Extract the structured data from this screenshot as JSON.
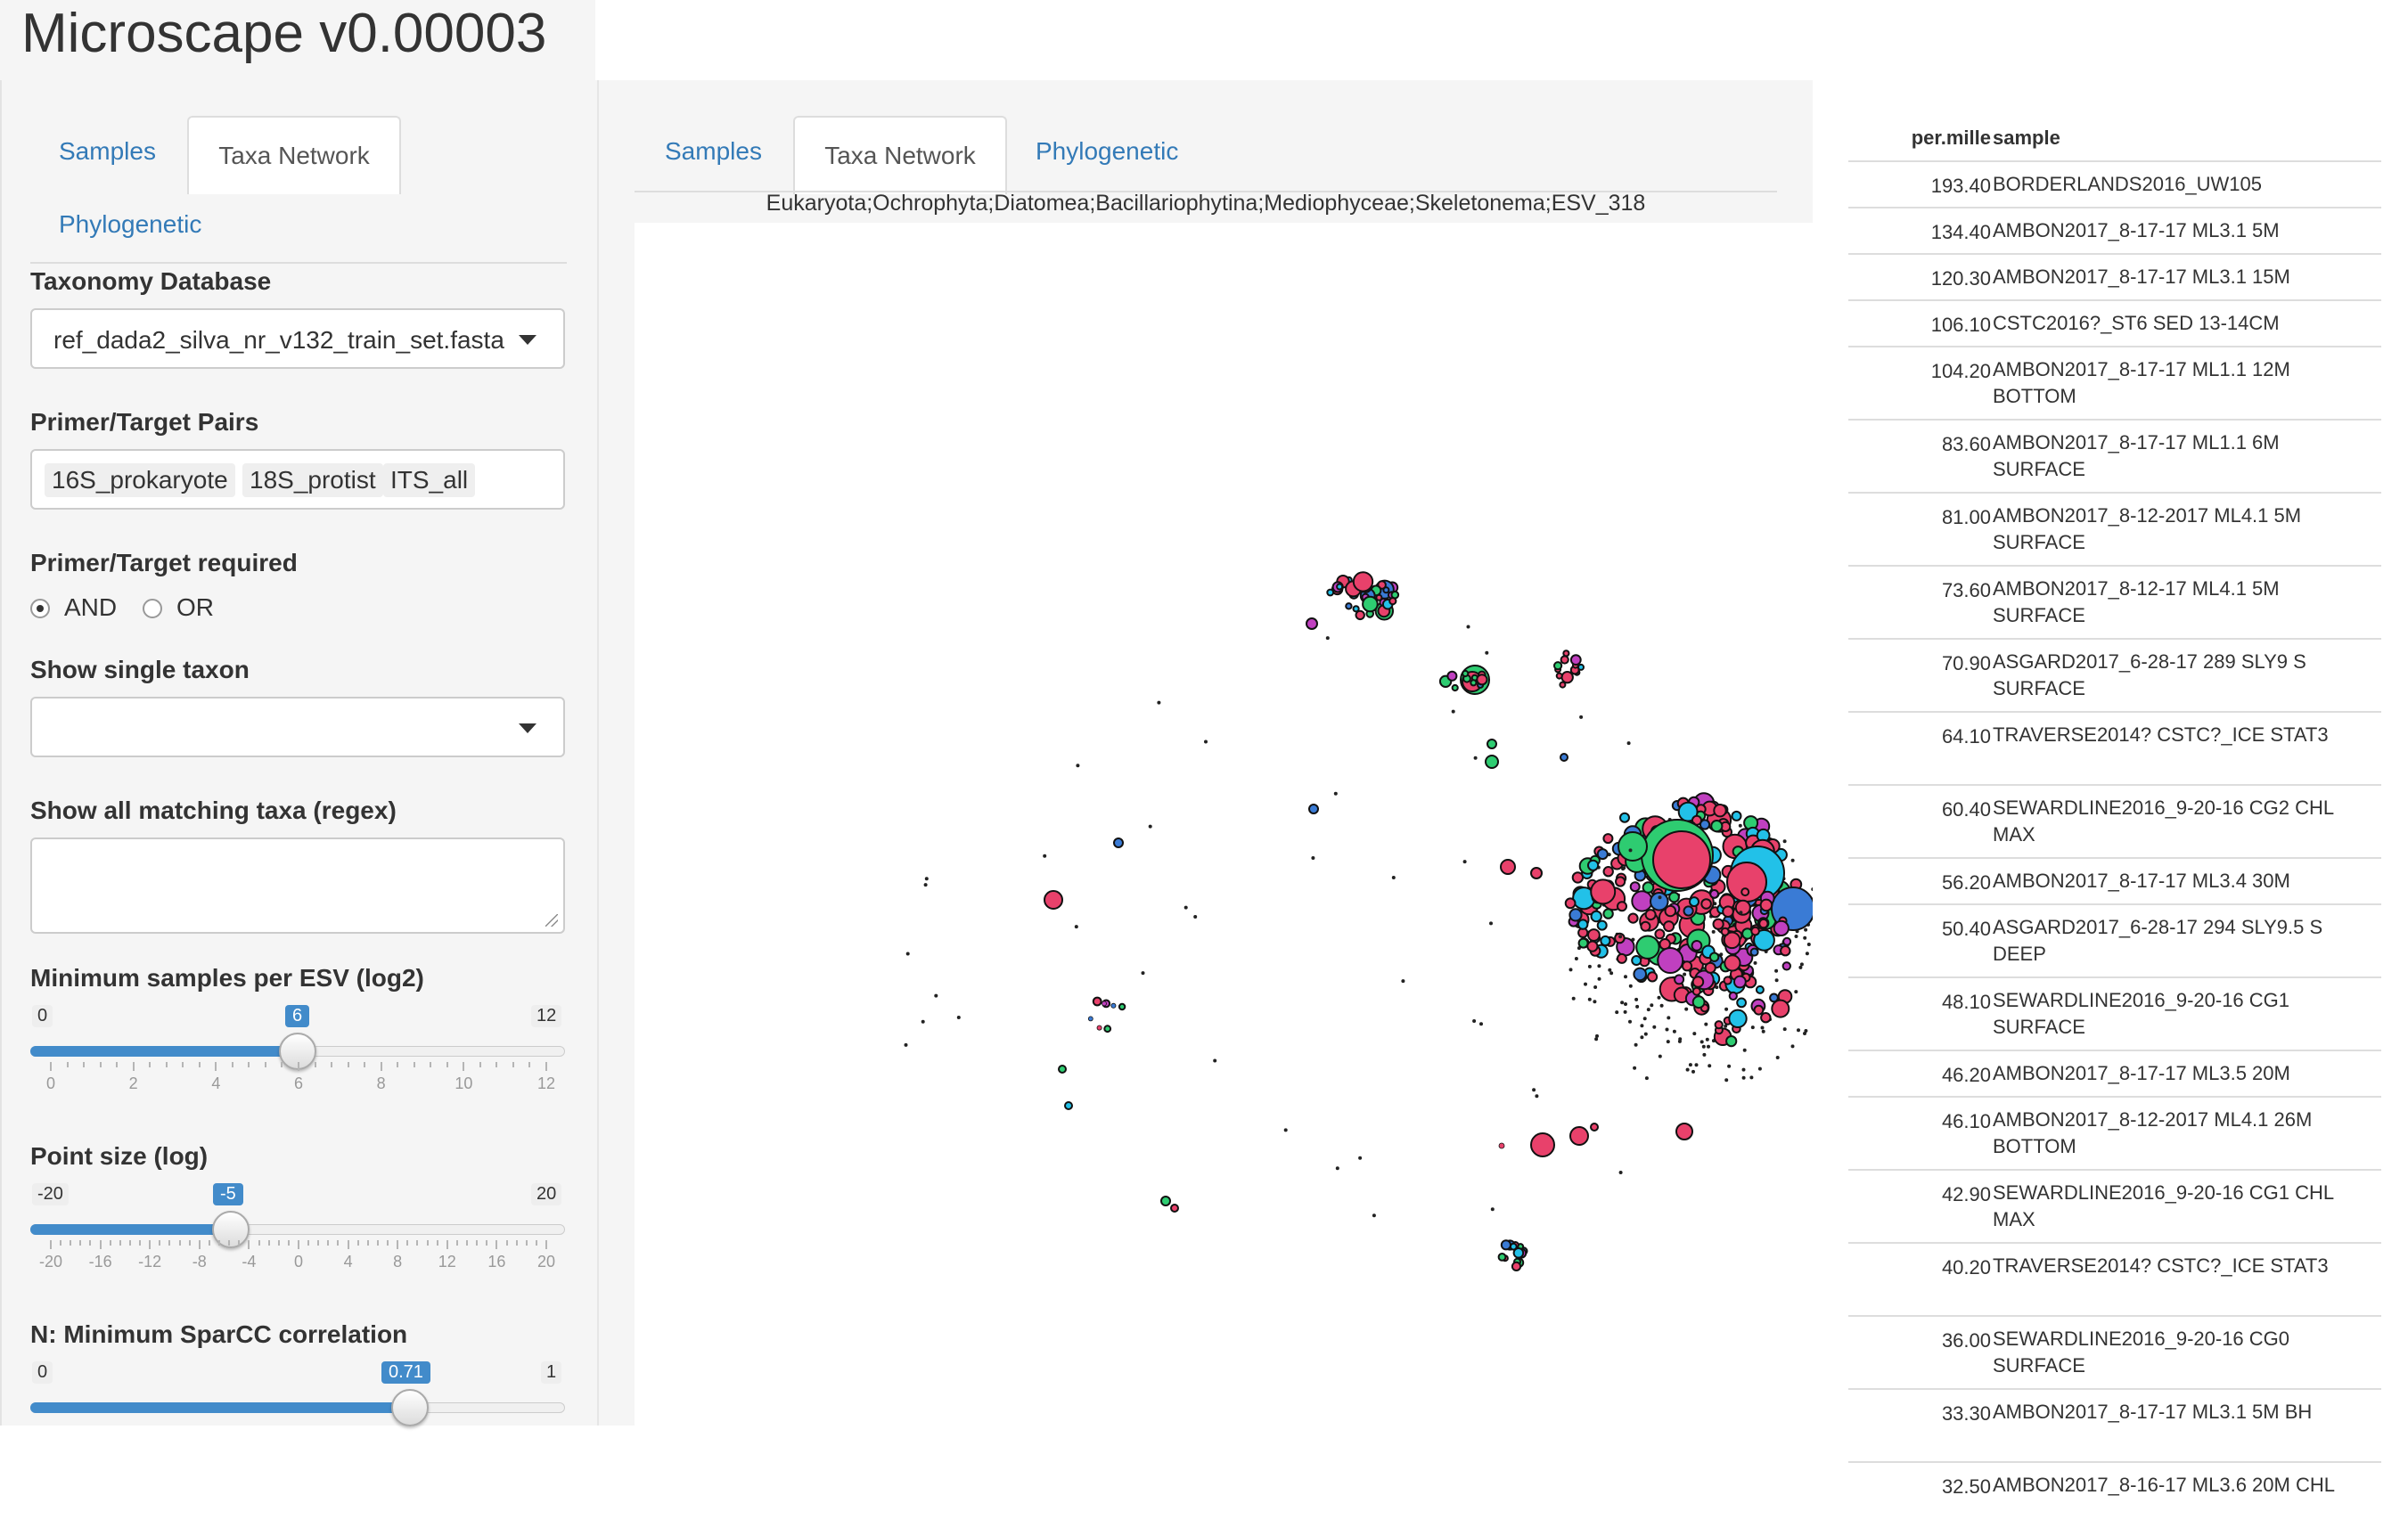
{
  "app": {
    "title": "Microscape v0.00003"
  },
  "sidebar": {
    "tabs": [
      {
        "label": "Samples",
        "active": false
      },
      {
        "label": "Taxa Network",
        "active": true
      },
      {
        "label": "Phylogenetic",
        "active": false
      }
    ],
    "taxonomy_db": {
      "label": "Taxonomy Database",
      "value": "ref_dada2_silva_nr_v132_train_set.fasta"
    },
    "primer_pairs": {
      "label": "Primer/Target Pairs",
      "chips": [
        "16S_prokaryote",
        "18S_protist",
        "ITS_all"
      ]
    },
    "primer_required": {
      "label": "Primer/Target required",
      "options": [
        "AND",
        "OR"
      ],
      "selected": "AND"
    },
    "single_taxon": {
      "label": "Show single taxon",
      "value": ""
    },
    "regex": {
      "label": "Show all matching taxa (regex)",
      "value": ""
    },
    "min_samples": {
      "label": "Minimum samples per ESV (log2)",
      "min": "0",
      "max": "12",
      "value": "6",
      "ticks": [
        "0",
        "2",
        "4",
        "6",
        "8",
        "10",
        "12"
      ],
      "fraction": 0.5
    },
    "point_size": {
      "label": "Point size (log)",
      "min": "-20",
      "max": "20",
      "value": "-5",
      "ticks": [
        "-20",
        "-16",
        "-12",
        "-8",
        "-4",
        "0",
        "4",
        "8",
        "12",
        "16",
        "20"
      ],
      "fraction": 0.375
    },
    "sparcc": {
      "label": "N: Minimum SparCC correlation",
      "min": "0",
      "max": "1",
      "value": "0.71",
      "fraction": 0.71
    }
  },
  "main": {
    "tabs": [
      {
        "label": "Samples",
        "active": false
      },
      {
        "label": "Taxa Network",
        "active": true
      },
      {
        "label": "Phylogenetic",
        "active": false
      }
    ],
    "network_title": "Eukaryota;Ochrophyta;Diatomea;Bacillariophytina;Mediophyceae;Skeletonema;ESV_318"
  },
  "colors": {
    "accent": "#337ab7",
    "slider": "#428bca",
    "node_pink": "#e8416b",
    "node_green": "#2ecc71",
    "node_blue": "#3a7bd5",
    "node_cyan": "#22c1e8",
    "node_magenta": "#c040c0"
  },
  "table": {
    "headers": [
      "per.mille",
      "sample"
    ],
    "rows": [
      [
        "193.40",
        "BORDERLANDS2016_UW105"
      ],
      [
        "134.40",
        "AMBON2017_8-17-17 ML3.1 5M"
      ],
      [
        "120.30",
        "AMBON2017_8-17-17 ML3.1 15M"
      ],
      [
        "106.10",
        "CSTC2016?_ST6 SED 13-14CM"
      ],
      [
        "104.20",
        "AMBON2017_8-17-17 ML1.1 12M BOTTOM"
      ],
      [
        "83.60",
        "AMBON2017_8-17-17 ML1.1 6M SURFACE"
      ],
      [
        "81.00",
        "AMBON2017_8-12-2017 ML4.1 5M SURFACE"
      ],
      [
        "73.60",
        "AMBON2017_8-12-17 ML4.1 5M SURFACE"
      ],
      [
        "70.90",
        "ASGARD2017_6-28-17 289 SLY9 S SURFACE"
      ],
      [
        "64.10",
        "TRAVERSE2014? CSTC?_ICE STAT3"
      ],
      [
        "60.40",
        "SEWARDLINE2016_9-20-16 CG2 CHL MAX"
      ],
      [
        "56.20",
        "AMBON2017_8-17-17 ML3.4 30M"
      ],
      [
        "50.40",
        "ASGARD2017_6-28-17 294 SLY9.5 S DEEP"
      ],
      [
        "48.10",
        "SEWARDLINE2016_9-20-16 CG1 SURFACE"
      ],
      [
        "46.20",
        "AMBON2017_8-17-17 ML3.5 20M"
      ],
      [
        "46.10",
        "AMBON2017_8-12-2017 ML4.1 26M BOTTOM"
      ],
      [
        "42.90",
        "SEWARDLINE2016_9-20-16 CG1 CHL MAX"
      ],
      [
        "40.20",
        "TRAVERSE2014? CSTC?_ICE STAT3"
      ],
      [
        "36.00",
        "SEWARDLINE2016_9-20-16 CG0 SURFACE"
      ],
      [
        "33.30",
        "AMBON2017_8-17-17 ML3.1 5M BH"
      ],
      [
        "32.50",
        "AMBON2017_8-16-17 ML3.6 20M CHL"
      ]
    ]
  }
}
